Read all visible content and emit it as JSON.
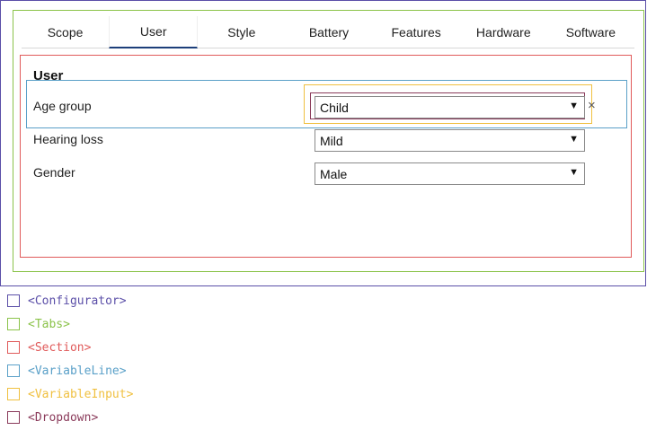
{
  "tabs": [
    {
      "label": "Scope"
    },
    {
      "label": "User",
      "active": true
    },
    {
      "label": "Style"
    },
    {
      "label": "Battery"
    },
    {
      "label": "Features"
    },
    {
      "label": "Hardware"
    },
    {
      "label": "Software"
    }
  ],
  "section": {
    "title": "User",
    "variables": [
      {
        "label": "Age group",
        "value": "Child",
        "clear_icon": "close-icon"
      },
      {
        "label": "Hearing loss",
        "value": "Mild"
      },
      {
        "label": "Gender",
        "value": "Male"
      }
    ]
  },
  "dropdown_arrow": "▼",
  "clear_glyph": "×",
  "legend": [
    {
      "text": "<Configurator>",
      "color": "#5b4fa8"
    },
    {
      "text": "<Tabs>",
      "color": "#8bc34a"
    },
    {
      "text": "<Section>",
      "color": "#e05a5a"
    },
    {
      "text": "<VariableLine>",
      "color": "#5aa0c8"
    },
    {
      "text": "<VariableInput>",
      "color": "#f0c040"
    },
    {
      "text": "<Dropdown>",
      "color": "#8a3a5a"
    }
  ]
}
